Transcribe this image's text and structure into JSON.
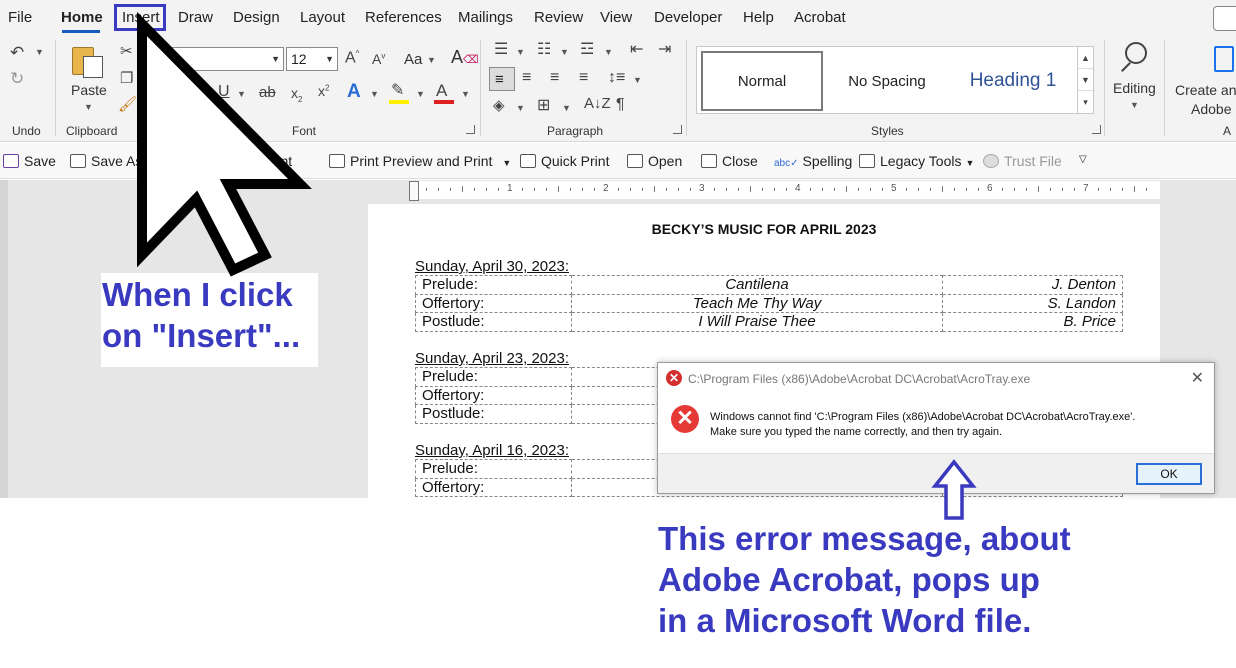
{
  "menu": {
    "tabs": [
      "File",
      "Home",
      "Insert",
      "Draw",
      "Design",
      "Layout",
      "References",
      "Mailings",
      "Review",
      "View",
      "Developer",
      "Help",
      "Acrobat"
    ]
  },
  "ribbon": {
    "undo_label": "Undo",
    "clipboard": {
      "paste_label": "Paste",
      "group_label": "Clipboard"
    },
    "font": {
      "family": "al",
      "size": "12",
      "group_label": "Font",
      "case_label": "Aa"
    },
    "paragraph": {
      "group_label": "Paragraph"
    },
    "styles": {
      "normal": "Normal",
      "no_spacing": "No Spacing",
      "heading1": "Heading 1",
      "group_label": "Styles"
    },
    "editing_label": "Editing",
    "create_label_1": "Create an",
    "create_label_2": "Adobe",
    "partial_label": "A"
  },
  "quick_toolbar": {
    "save": "Save",
    "save_as": "Save As",
    "comment": "ment",
    "print_preview": "Print Preview and Print",
    "quick_print": "Quick Print",
    "open": "Open",
    "close": "Close",
    "spelling": "Spelling",
    "legacy_tools": "Legacy Tools",
    "trust_file": "Trust File"
  },
  "ruler": {
    "numbers": [
      "1",
      "2",
      "3",
      "4",
      "5",
      "6",
      "7"
    ]
  },
  "document": {
    "title": "BECKY’S MUSIC FOR APRIL 2023",
    "sundays": [
      {
        "date": "Sunday, April 30, 2023:",
        "rows": [
          {
            "part": "Prelude:",
            "piece": "Cantilena",
            "composer": "J. Denton"
          },
          {
            "part": "Offertory:",
            "piece": "Teach Me Thy Way",
            "composer": "S. Landon"
          },
          {
            "part": "Postlude:",
            "piece": "I Will Praise Thee",
            "composer": "B. Price"
          }
        ]
      },
      {
        "date": "Sunday, April 23, 2023:",
        "rows": [
          {
            "part": "Prelude:",
            "piece": "",
            "composer": ""
          },
          {
            "part": "Offertory:",
            "piece": "",
            "composer": ""
          },
          {
            "part": "Postlude:",
            "piece": "",
            "composer": ""
          }
        ]
      },
      {
        "date": "Sunday, April 16, 2023:",
        "rows": [
          {
            "part": "Prelude:",
            "piece": "",
            "composer": ""
          },
          {
            "part": "Offertory:",
            "piece": "",
            "composer": ""
          }
        ]
      }
    ]
  },
  "error_dialog": {
    "title": "C:\\Program Files (x86)\\Adobe\\Acrobat DC\\Acrobat\\AcroTray.exe",
    "message_line1": "Windows cannot find 'C:\\Program Files (x86)\\Adobe\\Acrobat DC\\Acrobat\\AcroTray.exe'.",
    "message_line2": "Make sure you typed the name correctly, and then try again.",
    "ok_label": "OK"
  },
  "annotations": {
    "left_note": [
      "When I click",
      "on \"Insert\"..."
    ],
    "right_note": [
      "This error message, about",
      "Adobe Acrobat, pops up",
      "in a Microsoft Word file."
    ],
    "accent_color": "#3a3ac0"
  }
}
